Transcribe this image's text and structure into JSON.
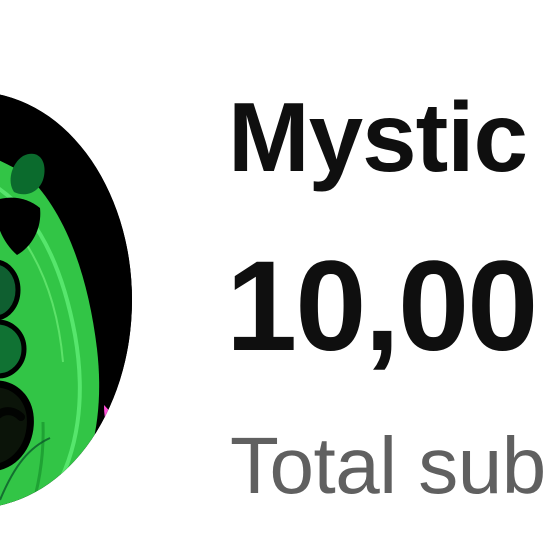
{
  "channel": {
    "name": "Mystic",
    "subscriber_count": "10,00",
    "subscriber_label": "Total sub"
  },
  "avatar": {
    "icon": "channel-avatar-icon",
    "colors": {
      "background": "#000000",
      "green_light": "#42d24d",
      "green_mid": "#20b838",
      "green_dark": "#0b5a2a",
      "dark": "#031007",
      "pink": "#ff4fd7"
    }
  },
  "colors": {
    "text_primary": "#0f0f0f",
    "text_secondary": "#606060",
    "background": "#ffffff"
  }
}
